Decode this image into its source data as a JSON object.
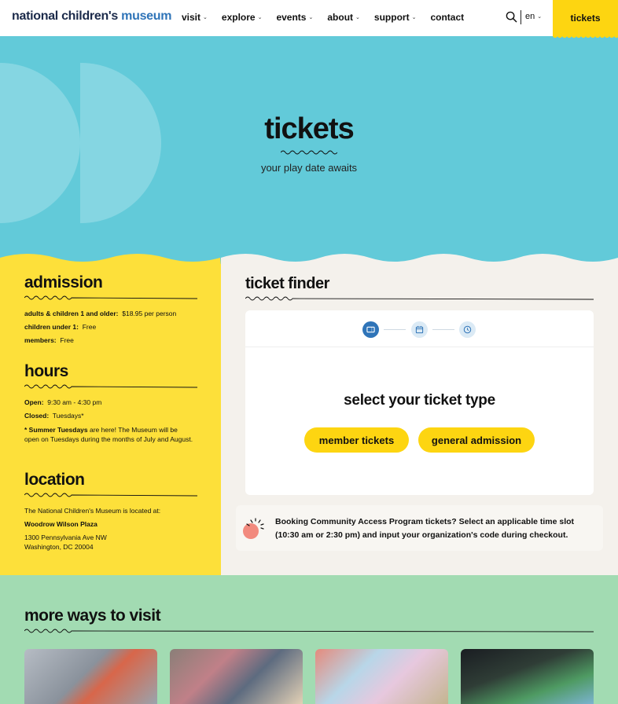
{
  "header": {
    "logo_main": "national children's ",
    "logo_accent": "museum",
    "nav": [
      {
        "label": "visit",
        "has_dropdown": true
      },
      {
        "label": "explore",
        "has_dropdown": true
      },
      {
        "label": "events",
        "has_dropdown": true
      },
      {
        "label": "about",
        "has_dropdown": true
      },
      {
        "label": "support",
        "has_dropdown": true
      },
      {
        "label": "contact",
        "has_dropdown": false
      }
    ],
    "language": "en",
    "tickets_button": "tickets"
  },
  "hero": {
    "title": "tickets",
    "subtitle": "your play date awaits"
  },
  "admission": {
    "title": "admission",
    "rows": [
      {
        "label": "adults & children 1 and older:",
        "value": "$18.95 per person"
      },
      {
        "label": "children under 1:",
        "value": "Free"
      },
      {
        "label": "members:",
        "value": "Free"
      }
    ]
  },
  "hours": {
    "title": "hours",
    "open_label": "Open:",
    "open_value": "9:30 am - 4:30 pm",
    "closed_label": "Closed:",
    "closed_value": "Tuesdays*",
    "note_bold": "* Summer Tuesdays",
    "note_text": " are here! The Museum will be open on Tuesdays during the months of July and August."
  },
  "location": {
    "title": "location",
    "intro": "The National Children's Museum is located at:",
    "place": "Woodrow Wilson Plaza",
    "address_line1": "1300 Pennsylvania Ave NW",
    "address_line2": "Washington, DC 20004"
  },
  "ticket_finder": {
    "title": "ticket finder",
    "steps": [
      "ticket-icon",
      "calendar-icon",
      "clock-icon"
    ],
    "active_step": 1,
    "prompt": "select your ticket type",
    "member_button": "member tickets",
    "general_button": "general admission"
  },
  "cap_notice": {
    "text": "Booking Community Access Program tickets? Select an applicable time slot (10:30 am or 2:30 pm) and input your organization's code during checkout."
  },
  "more_ways": {
    "title": "more ways to visit"
  },
  "colors": {
    "hero_bg": "#62cad9",
    "yellow": "#fdd511",
    "left_bg": "#fde03a",
    "right_bg": "#f4f1ec",
    "green_bg": "#a2dbb2",
    "accent_blue": "#2f74b8"
  }
}
